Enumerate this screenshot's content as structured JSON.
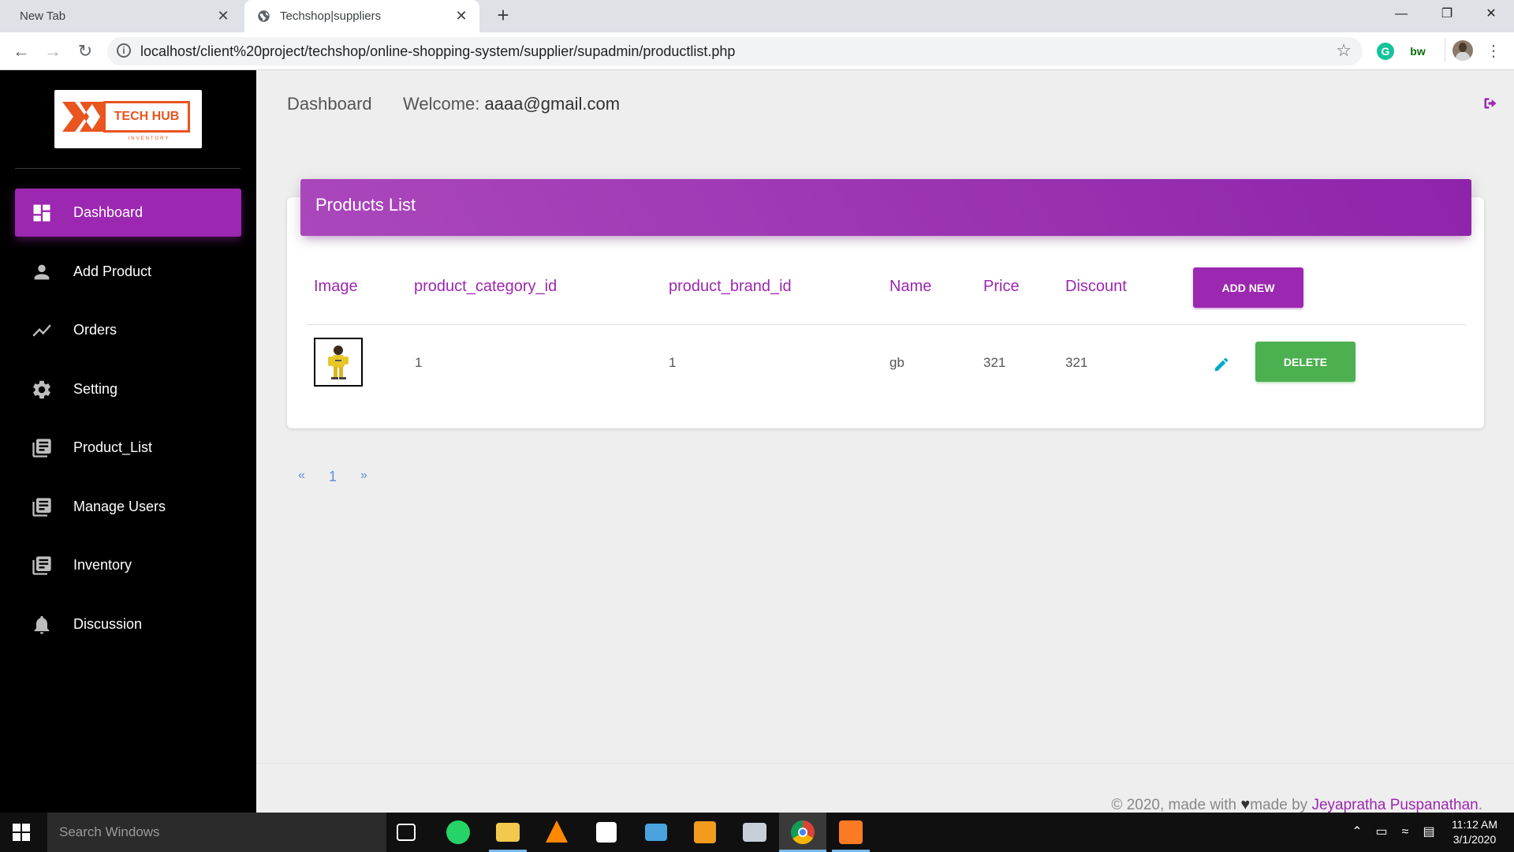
{
  "browser": {
    "tabs": [
      {
        "title": "New Tab",
        "active": false
      },
      {
        "title": "Techshop|suppliers",
        "active": true
      }
    ],
    "new_tab_symbol": "+",
    "close_symbol": "✕",
    "window_controls": {
      "minimize": "—",
      "maximize": "❐",
      "close": "✕"
    },
    "url": "localhost/client%20project/techshop/online-shopping-system/supplier/supadmin/productlist.php",
    "extensions": [
      {
        "icon": "grammarly-icon",
        "label": "G",
        "color": "#15c39a"
      },
      {
        "icon": "bw-extension-icon",
        "label": "bw",
        "color": "#0b6b0b"
      }
    ]
  },
  "sidebar": {
    "logo": {
      "brand": "TECH HUB",
      "subtitle": "INVENTORY",
      "accent": "#e9541f"
    },
    "items": [
      {
        "label": "Dashboard",
        "icon": "dashboard-icon",
        "active": true
      },
      {
        "label": "Add Product",
        "icon": "person-icon",
        "active": false
      },
      {
        "label": "Orders",
        "icon": "trending-icon",
        "active": false
      },
      {
        "label": "Setting",
        "icon": "gear-icon",
        "active": false
      },
      {
        "label": "Product_List",
        "icon": "library-books-icon",
        "active": false
      },
      {
        "label": "Manage Users",
        "icon": "library-books-icon",
        "active": false
      },
      {
        "label": "Inventory",
        "icon": "library-books-icon",
        "active": false
      },
      {
        "label": "Discussion",
        "icon": "bell-icon",
        "active": false
      }
    ]
  },
  "topnav": {
    "title": "Dashboard",
    "welcome_prefix": "Welcome:",
    "email": "aaaa@gmail.com"
  },
  "card": {
    "title": "Products List",
    "columns": [
      "Image",
      "product_category_id",
      "product_brand_id",
      "Name",
      "Price",
      "Discount"
    ],
    "add_button": "ADD NEW",
    "rows": [
      {
        "category_id": "1",
        "brand_id": "1",
        "name": "gb",
        "price": "321",
        "discount": "321",
        "delete_label": "DELETE"
      }
    ]
  },
  "pagination": {
    "prev": "«",
    "current": "1",
    "next": "»"
  },
  "footer": {
    "prefix": "© 2020, made with",
    "heart": "♥",
    "middle": "made by",
    "author": "Jeyapratha Puspanathan",
    "suffix": "."
  },
  "taskbar": {
    "search_placeholder": "Search Windows",
    "time": "11:12 AM",
    "date": "3/1/2020"
  },
  "colors": {
    "primary": "#9c27b0",
    "success": "#4caf50",
    "sidebar_bg": "#000000",
    "page_bg": "#eeeeee"
  }
}
